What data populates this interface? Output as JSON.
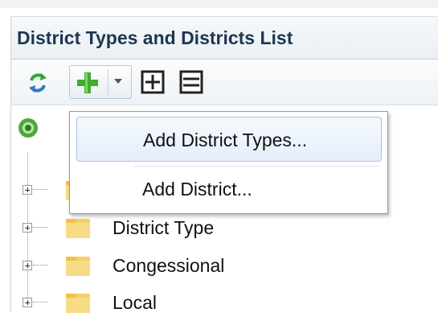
{
  "panel": {
    "title": "District Types and Districts List"
  },
  "toolbar": {
    "buttons": [
      {
        "name": "refresh",
        "icon": "refresh-icon"
      },
      {
        "name": "add",
        "icon": "plus-icon",
        "has_dropdown": true
      },
      {
        "name": "expand-all",
        "icon": "expand-all-icon"
      },
      {
        "name": "collapse-all",
        "icon": "collapse-all-icon"
      }
    ]
  },
  "menu": {
    "items": [
      {
        "label": "Add District Types..."
      },
      {
        "label": "Add District..."
      }
    ]
  },
  "tree": {
    "root_icon": "root-node-icon",
    "nodes": [
      {
        "label": ""
      },
      {
        "label": "District Type"
      },
      {
        "label": "Congessional"
      },
      {
        "label": "Local"
      }
    ]
  },
  "colors": {
    "title_text": "#1f3650",
    "header_bg": "#e9eff5",
    "plus_green": "#3fae2a",
    "refresh_green": "#33a532",
    "refresh_blue": "#2d7bc4",
    "folder": "#f5d067",
    "menu_hover_border": "#a8c4e6"
  }
}
